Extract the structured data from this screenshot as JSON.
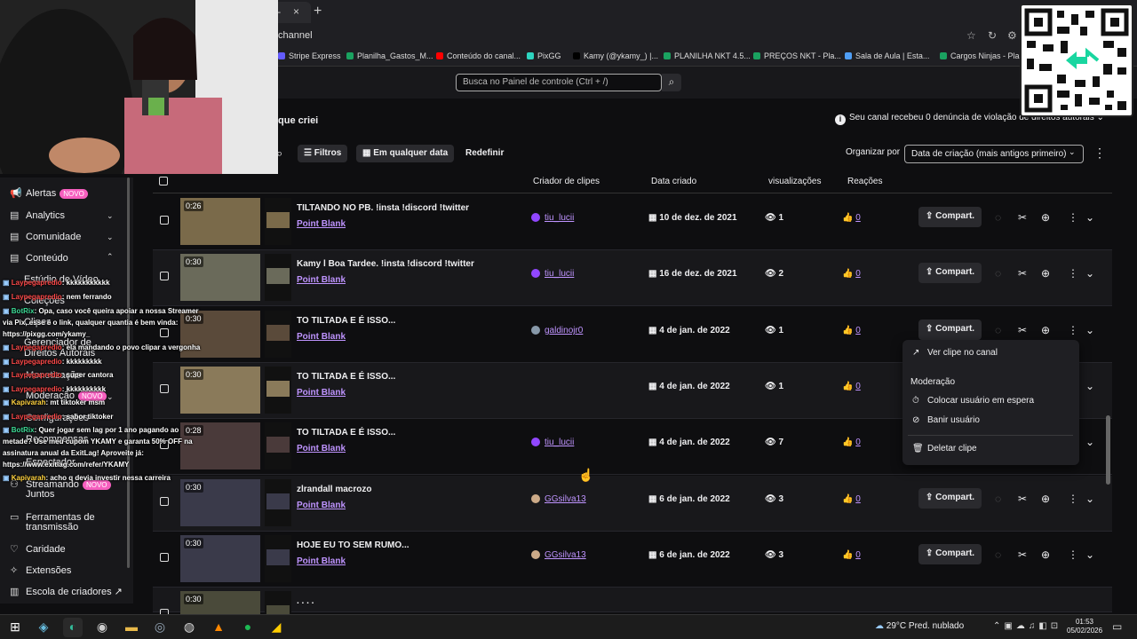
{
  "browser": {
    "tab_close": "×",
    "new_tab": "+",
    "address": "channel",
    "bookmarks": [
      {
        "label": "Stripe Express",
        "color": "#635bff"
      },
      {
        "label": "Planilha_Gastos_M...",
        "color": "#1aa260"
      },
      {
        "label": "Conteúdo do canal...",
        "color": "#ff0000"
      },
      {
        "label": "PixGG",
        "color": "#2dd4bf"
      },
      {
        "label": "Kamy (@ykamy_) |...",
        "color": "#000000"
      },
      {
        "label": "PLANILHA NKT 4.5...",
        "color": "#1aa260"
      },
      {
        "label": "PREÇOS NKT - Pla...",
        "color": "#1aa260"
      },
      {
        "label": "Sala de Aula | Esta...",
        "color": "#4f9ef5"
      },
      {
        "label": "Cargos Ninjas - Pla...",
        "color": "#1aa260"
      }
    ]
  },
  "topbar": {
    "search_placeholder": "Busca no Painel de controle (Ctrl + /)"
  },
  "page": {
    "heading": "que criei",
    "notice": "Seu canal recebeu 0 denúncia de violação de direitos autorais"
  },
  "filters": {
    "filters_label": "Filtros",
    "date_label": "Em qualquer data",
    "reset_label": "Redefinir",
    "sort_label": "Organizar por",
    "sort_value": "Data de criação (mais antigos primeiro)"
  },
  "columns": {
    "creator": "Criador de clipes",
    "date": "Data criado",
    "views": "visualizações",
    "reactions": "Reações"
  },
  "share_label": "Compart.",
  "clips": [
    {
      "duration": "0:26",
      "title": "TILTANDO NO PB. !insta !discord !twitter",
      "game": "Point Blank",
      "creator": "tiu_lucii",
      "avatar": "#9147ff",
      "date": "10 de dez. de 2021",
      "views": "1",
      "reactions": "0",
      "thumb": "#7a6a4a"
    },
    {
      "duration": "0:30",
      "title": "Kamy l Boa Tardee. !insta !discord !twitter",
      "game": "Point Blank",
      "creator": "tiu_lucii",
      "avatar": "#9147ff",
      "date": "16 de dez. de 2021",
      "views": "2",
      "reactions": "0",
      "thumb": "#6a6a5a"
    },
    {
      "duration": "0:30",
      "title": "TO TILTADA E É ISSO...",
      "game": "Point Blank",
      "creator": "galdinojr0",
      "avatar": "#8899aa",
      "date": "4 de jan. de 2022",
      "views": "1",
      "reactions": "0",
      "thumb": "#5a4a3a"
    },
    {
      "duration": "0:30",
      "title": "TO TILTADA E É ISSO...",
      "game": "Point Blank",
      "creator": "",
      "avatar": "",
      "date": "4 de jan. de 2022",
      "views": "1",
      "reactions": "0",
      "thumb": "#8a7a5a"
    },
    {
      "duration": "0:28",
      "title": "TO TILTADA E É ISSO...",
      "game": "Point Blank",
      "creator": "tiu_lucii",
      "avatar": "#9147ff",
      "date": "4 de jan. de 2022",
      "views": "7",
      "reactions": "0",
      "thumb": "#4a3a3a"
    },
    {
      "duration": "0:30",
      "title": "zlrandall macrozo",
      "game": "Point Blank",
      "creator": "GGsilva13",
      "avatar": "#ccaa88",
      "date": "6 de jan. de 2022",
      "views": "3",
      "reactions": "0",
      "thumb": "#3a3a4a"
    },
    {
      "duration": "0:30",
      "title": "HOJE EU TO SEM RUMO...",
      "game": "Point Blank",
      "creator": "GGsilva13",
      "avatar": "#ccaa88",
      "date": "6 de jan. de 2022",
      "views": "3",
      "reactions": "0",
      "thumb": "#3a3a4a"
    },
    {
      "duration": "0:30",
      "title": ". . . .",
      "game": "",
      "creator": "",
      "avatar": "",
      "date": "",
      "views": "",
      "reactions": "",
      "thumb": "#4a4a3a"
    }
  ],
  "popup": {
    "view_clip": "Ver clipe no canal",
    "moderation": "Moderação",
    "timeout": "Colocar usuário em espera",
    "ban": "Banir usuário",
    "delete": "Deletar clipe"
  },
  "sidebar": {
    "alerts": "Alertas",
    "new_badge": "NOVO",
    "analytics": "Analytics",
    "community": "Comunidade",
    "content": "Conteúdo",
    "video_studio": "Estúdio de Vídeo",
    "collections": "Coleções",
    "clips": "Clipes",
    "rights_manager_1": "Gerenciador de",
    "rights_manager_2": "Direitos Autorais",
    "monetization": "Monetização",
    "moderation": "Moderação",
    "settings": "Configurações",
    "rewards": "Recompensas",
    "spectator": "Espectador",
    "stream_together_1": "Streamando",
    "stream_together_2": "Juntos",
    "tools_1": "Ferramentas de",
    "tools_2": "transmissão",
    "charity": "Caridade",
    "extensions": "Extensões",
    "creator_school": "Escola de criadores"
  },
  "chat": [
    {
      "user": "Laypegapredio",
      "text": ": kkkkkkkkkkk",
      "color": "u1"
    },
    {
      "user": "Laypegapredio",
      "text": ": nem ferrando",
      "color": "u1"
    },
    {
      "user": "BotRix",
      "text": ": Opa, caso você queira apoiar a nossa Streamer",
      "color": "u4"
    },
    {
      "user": "",
      "text": "via Pix, esse é o link, qualquer quantia é bem vinda:",
      "color": ""
    },
    {
      "user": "",
      "text": "https://pixgg.com/ykamy_",
      "color": ""
    },
    {
      "user": "Laypegapredio",
      "text": ": ela mandando o povo clipar a vergonha",
      "color": "u1"
    },
    {
      "user": "Laypegapredio",
      "text": ": kkkkkkkkk",
      "color": "u1"
    },
    {
      "user": "Laypegapredio",
      "text": ": super cantora",
      "color": "u1"
    },
    {
      "user": "Laypegapredio",
      "text": ": kkkkkkkkkk",
      "color": "u1"
    },
    {
      "user": "Kapivarah",
      "text": ": mt tiktoker msm",
      "color": "u2"
    },
    {
      "user": "Laypegapredio",
      "text": ": sabor tiktoker",
      "color": "u1"
    },
    {
      "user": "BotRix",
      "text": ": Quer jogar sem lag por 1 ano pagando ao",
      "color": "u4"
    },
    {
      "user": "",
      "text": "metade? Use meu cupom YKAMY e garanta 50% OFF na",
      "color": ""
    },
    {
      "user": "",
      "text": "assinatura anual da ExitLag! Aproveite já:",
      "color": ""
    },
    {
      "user": "",
      "text": "https://www.exitlag.com/refer/YKAMY",
      "color": ""
    },
    {
      "user": "Kapivarah",
      "text": ": acho q devia investir nessa carreira",
      "color": "u2"
    }
  ],
  "taskbar": {
    "weather": "29°C  Pred. nublado",
    "time": "01:53",
    "date": "05/02/2026"
  }
}
